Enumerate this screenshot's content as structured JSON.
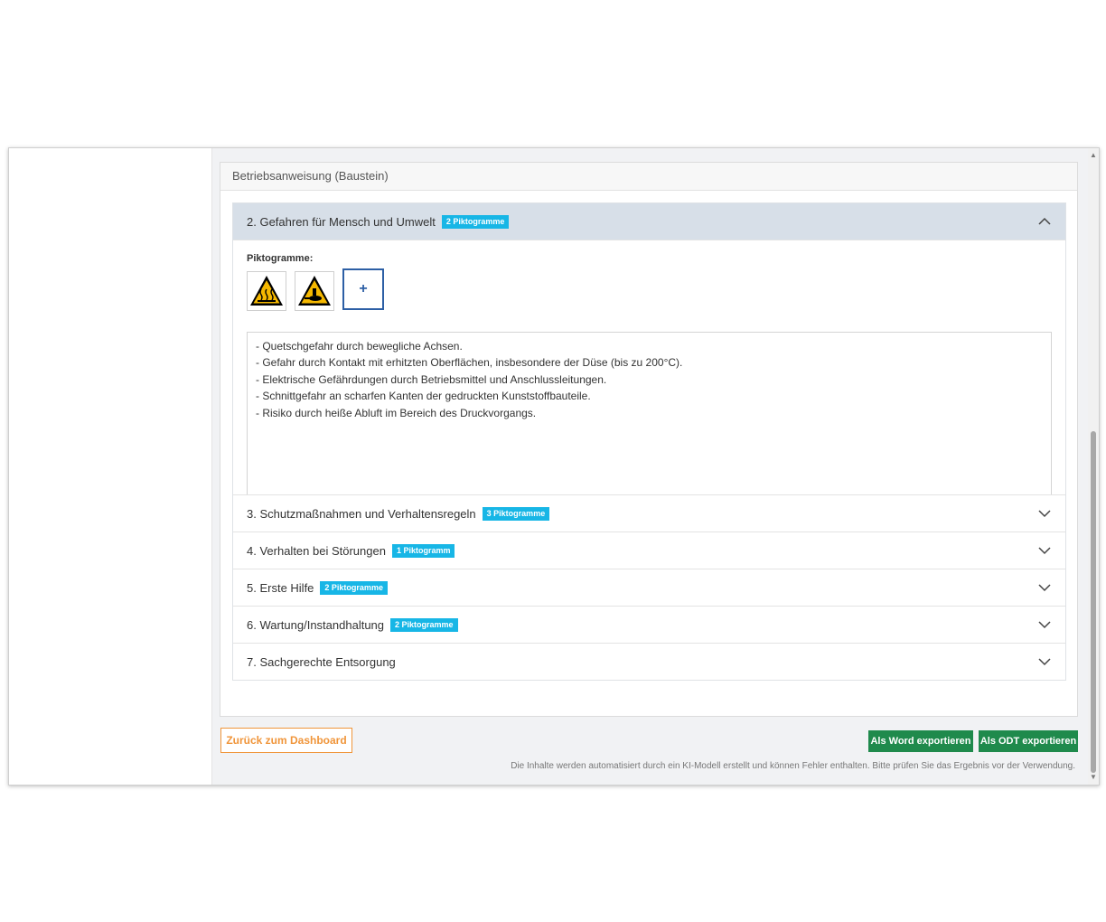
{
  "card": {
    "title": "Betriebsanweisung (Baustein)"
  },
  "sections": [
    {
      "label": "2. Gefahren für Mensch und Umwelt",
      "badge": "2 Piktogramme",
      "expanded": true
    },
    {
      "label": "3. Schutzmaßnahmen und Verhaltensregeln",
      "badge": "3 Piktogramme",
      "expanded": false
    },
    {
      "label": "4. Verhalten bei Störungen",
      "badge": "1 Piktogramm",
      "expanded": false
    },
    {
      "label": "5. Erste Hilfe",
      "badge": "2 Piktogramme",
      "expanded": false
    },
    {
      "label": "6. Wartung/Instandhaltung",
      "badge": "2 Piktogramme",
      "expanded": false
    },
    {
      "label": "7. Sachgerechte Entsorgung",
      "badge": "",
      "expanded": false
    }
  ],
  "expanded_section": {
    "pictograms_label": "Piktogramme:",
    "pictograms": [
      "hot-surface-warning-icon",
      "hand-crush-warning-icon"
    ],
    "add_label": "+",
    "text_lines": [
      "- Quetschgefahr durch bewegliche Achsen.",
      "- Gefahr durch Kontakt mit erhitzten Oberflächen, insbesondere der Düse (bis zu 200°C).",
      "- Elektrische Gefährdungen durch Betriebsmittel und Anschlussleitungen.",
      "- Schnittgefahr an scharfen Kanten der gedruckten Kunststoffbauteile.",
      "- Risiko durch heiße Abluft im Bereich des Druckvorgangs."
    ]
  },
  "footer": {
    "back_label": "Zurück zum Dashboard",
    "word_label": "Als Word exportieren",
    "odt_label": "Als ODT exportieren",
    "disclaimer": "Die Inhalte werden automatisiert durch ein KI-Modell erstellt und können Fehler enthalten. Bitte prüfen Sie das Ergebnis vor der Verwendung."
  },
  "colors": {
    "badge": "#17b6e6",
    "expanded_header": "#d7dfe8",
    "export_button": "#1f8a4c",
    "back_button": "#f0953a",
    "add_button": "#2d5fa5"
  }
}
